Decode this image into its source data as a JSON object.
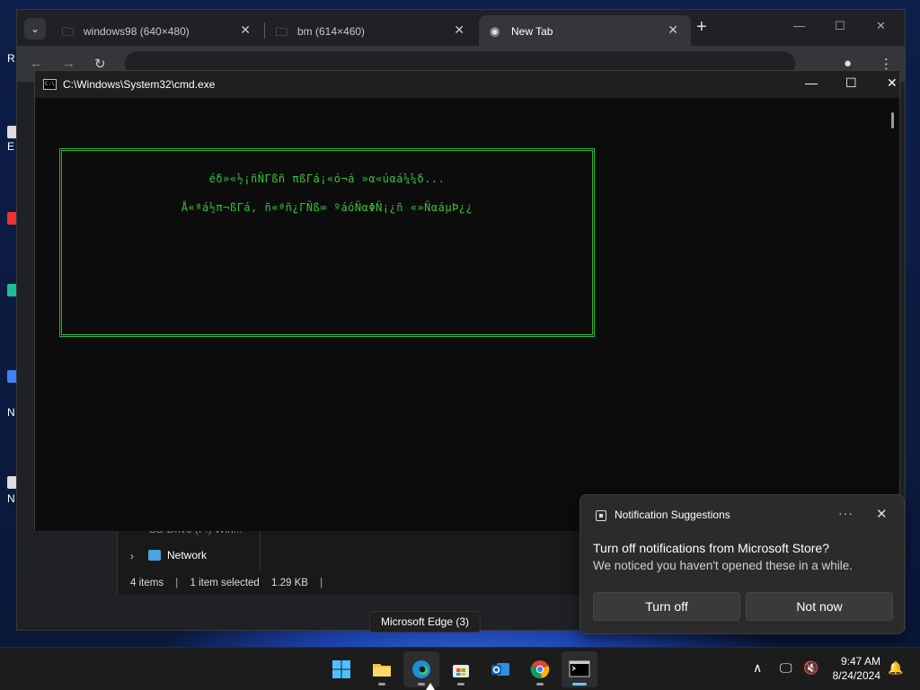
{
  "desktop": {
    "fragments": [
      "R",
      "E",
      "N",
      "N"
    ]
  },
  "browser": {
    "tabs": [
      {
        "title": "windows98 (640×480)",
        "icon": "folder-icon"
      },
      {
        "title": "bm (614×460)",
        "icon": "folder-icon"
      },
      {
        "title": "New Tab",
        "icon": "chrome-icon"
      }
    ],
    "new_tab_glyph": "+",
    "close_glyph": "✕",
    "minimize_glyph": "—",
    "maximize_glyph": "☐"
  },
  "cmd": {
    "title": "C:\\Windows\\System32\\cmd.exe",
    "icon_text": "C:\\",
    "minimize_glyph": "—",
    "maximize_glyph": "☐",
    "close_glyph": "✕",
    "line1": "éδ»«½¡ñÑΓßñ πßΓá¡«ó¬á »α«úαá¼¼δ...",
    "line2": "Å«ªá½π¬ßΓá, ñ«ªñ¿ΓÑß∞ ºáóÑαΦÑ¡¿ñ «»ÑαáµÞ¿¿"
  },
  "explorer": {
    "faded_item": "CD Drive (F:) Win...",
    "network_label": "Network",
    "status": {
      "items": "4 items",
      "selected": "1 item selected",
      "size": "1.29 KB"
    }
  },
  "notification": {
    "app_name": "Notification Suggestions",
    "more_glyph": "···",
    "close_glyph": "✕",
    "heading": "Turn off notifications from Microsoft Store?",
    "body": "We noticed you haven't opened these in a while.",
    "primary_button": "Turn off",
    "secondary_button": "Not now"
  },
  "tooltip": "Microsoft Edge (3)",
  "taskbar": {
    "apps": [
      "start",
      "file-explorer",
      "edge",
      "microsoft-store",
      "outlook",
      "chrome",
      "terminal"
    ],
    "time": "9:47 AM",
    "date": "8/24/2024",
    "tray_chevron": "∧",
    "accent": "#60cdff"
  }
}
